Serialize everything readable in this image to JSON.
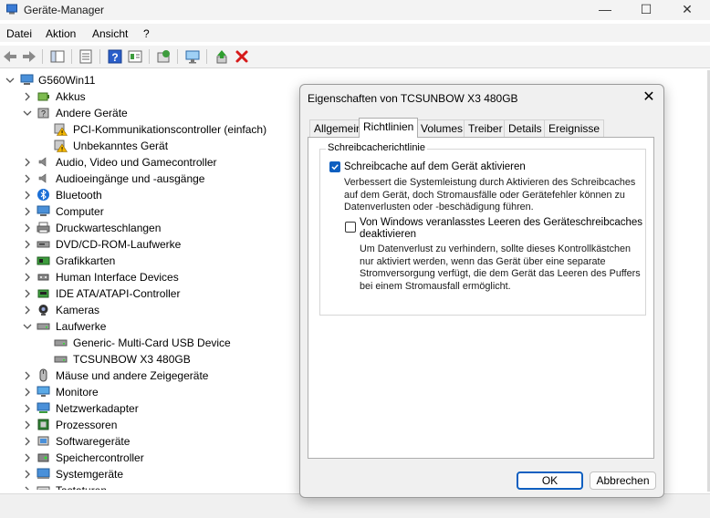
{
  "window": {
    "title": "Geräte-Manager",
    "controls": {
      "minimize": "—",
      "maximize": "☐",
      "close": "✕"
    }
  },
  "menu": [
    "Datei",
    "Aktion",
    "Ansicht",
    "?"
  ],
  "toolbar": [
    "back-icon",
    "forward-icon",
    "properties-pane-icon",
    "properties-icon",
    "help-icon",
    "view-icon",
    "update-driver-icon",
    "monitor-icon",
    "enable-device-icon",
    "uninstall-icon"
  ],
  "tree": {
    "root": "G560Win11",
    "items": [
      {
        "label": "Akkus",
        "icon": "battery-icon",
        "chevron": "right",
        "level": 1
      },
      {
        "label": "Andere Geräte",
        "icon": "unknown-device-icon",
        "chevron": "down",
        "level": 1
      },
      {
        "label": "PCI-Kommunikationscontroller (einfach)",
        "icon": "warning-device-icon",
        "chevron": "none",
        "level": 2
      },
      {
        "label": "Unbekanntes Gerät",
        "icon": "warning-device-icon",
        "chevron": "none",
        "level": 2
      },
      {
        "label": "Audio, Video und Gamecontroller",
        "icon": "speaker-icon",
        "chevron": "right",
        "level": 1
      },
      {
        "label": "Audioeingänge und -ausgänge",
        "icon": "speaker-icon",
        "chevron": "right",
        "level": 1
      },
      {
        "label": "Bluetooth",
        "icon": "bluetooth-icon",
        "chevron": "right",
        "level": 1
      },
      {
        "label": "Computer",
        "icon": "computer-icon",
        "chevron": "right",
        "level": 1
      },
      {
        "label": "Druckwarteschlangen",
        "icon": "printer-icon",
        "chevron": "right",
        "level": 1
      },
      {
        "label": "DVD/CD-ROM-Laufwerke",
        "icon": "dvd-drive-icon",
        "chevron": "right",
        "level": 1
      },
      {
        "label": "Grafikkarten",
        "icon": "display-adapter-icon",
        "chevron": "right",
        "level": 1
      },
      {
        "label": "Human Interface Devices",
        "icon": "hid-icon",
        "chevron": "right",
        "level": 1
      },
      {
        "label": "IDE ATA/ATAPI-Controller",
        "icon": "ide-controller-icon",
        "chevron": "right",
        "level": 1
      },
      {
        "label": "Kameras",
        "icon": "camera-icon",
        "chevron": "right",
        "level": 1
      },
      {
        "label": "Laufwerke",
        "icon": "disk-drive-icon",
        "chevron": "down",
        "level": 1
      },
      {
        "label": "Generic- Multi-Card USB Device",
        "icon": "disk-drive-icon",
        "chevron": "none",
        "level": 2
      },
      {
        "label": "TCSUNBOW X3 480GB",
        "icon": "disk-drive-icon",
        "chevron": "none",
        "level": 2
      },
      {
        "label": "Mäuse und andere Zeigegeräte",
        "icon": "mouse-icon",
        "chevron": "right",
        "level": 1
      },
      {
        "label": "Monitore",
        "icon": "monitor-icon",
        "chevron": "right",
        "level": 1
      },
      {
        "label": "Netzwerkadapter",
        "icon": "network-adapter-icon",
        "chevron": "right",
        "level": 1
      },
      {
        "label": "Prozessoren",
        "icon": "processor-icon",
        "chevron": "right",
        "level": 1
      },
      {
        "label": "Softwaregeräte",
        "icon": "software-device-icon",
        "chevron": "right",
        "level": 1
      },
      {
        "label": "Speichercontroller",
        "icon": "storage-controller-icon",
        "chevron": "right",
        "level": 1
      },
      {
        "label": "Systemgeräte",
        "icon": "system-device-icon",
        "chevron": "right",
        "level": 1
      },
      {
        "label": "Tastaturen",
        "icon": "keyboard-icon",
        "chevron": "right",
        "level": 1
      }
    ]
  },
  "dialog": {
    "title": "Eigenschaften von TCSUNBOW X3 480GB",
    "close": "✕",
    "tabs": [
      "Allgemein",
      "Richtlinien",
      "Volumes",
      "Treiber",
      "Details",
      "Ereignisse"
    ],
    "active_tab": "Richtlinien",
    "group_title": "Schreibcacherichtlinie",
    "option1": {
      "label": "Schreibcache auf dem Gerät aktivieren",
      "checked": true,
      "desc": [
        "Verbessert die Systemleistung durch Aktivieren des Schreibcaches",
        "auf dem Gerät, doch Stromausfälle oder Gerätefehler können zu",
        "Datenverlusten oder -beschädigung führen."
      ]
    },
    "option2": {
      "label": [
        "Von Windows veranlasstes Leeren des Geräteschreibcaches",
        "deaktivieren"
      ],
      "checked": false,
      "desc": [
        "Um Datenverlust zu verhindern, sollte dieses Kontrollkästchen",
        "nur aktiviert werden, wenn das Gerät über eine separate",
        "Stromversorgung verfügt, die dem Gerät das Leeren des Puffers",
        "bei einem Stromausfall ermöglicht."
      ]
    },
    "ok": "OK",
    "cancel": "Abbrechen"
  },
  "colors": {
    "accent": "#0e5fc0",
    "warning": "#f2b600",
    "uninstall": "#d61a1a",
    "enable": "#2f9e2f"
  }
}
